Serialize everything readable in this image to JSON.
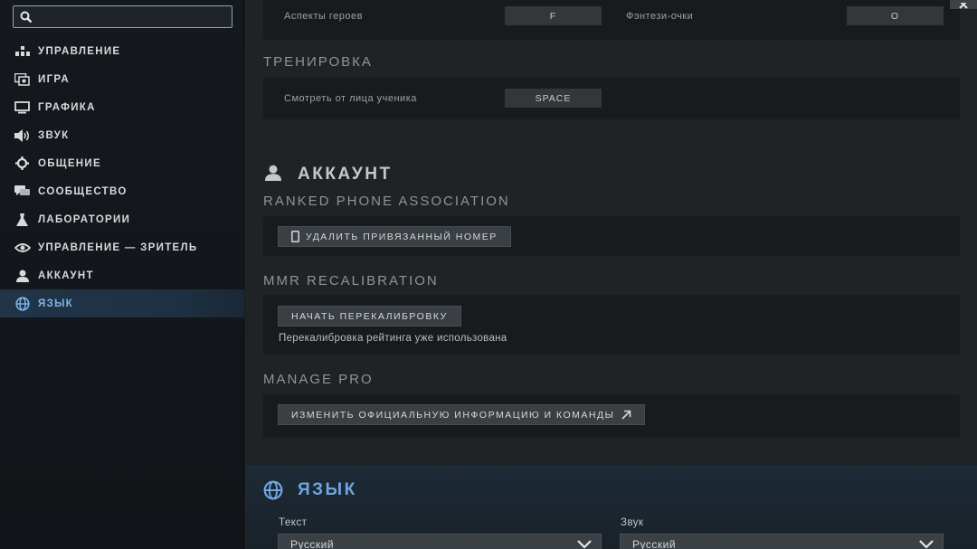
{
  "search": {
    "placeholder": "",
    "value": ""
  },
  "sidebar": {
    "items": [
      {
        "label": "УПРАВЛЕНИЕ",
        "icon": "controls-icon"
      },
      {
        "label": "ИГРА",
        "icon": "game-icon"
      },
      {
        "label": "ГРАФИКА",
        "icon": "monitor-icon"
      },
      {
        "label": "ЗВУК",
        "icon": "speaker-icon"
      },
      {
        "label": "ОБЩЕНИЕ",
        "icon": "gear-icon"
      },
      {
        "label": "СООБЩЕСТВО",
        "icon": "chat-icon"
      },
      {
        "label": "ЛАБОРАТОРИИ",
        "icon": "flask-icon"
      },
      {
        "label": "УПРАВЛЕНИЕ — ЗРИТЕЛЬ",
        "icon": "eye-icon"
      },
      {
        "label": "АККАУНТ",
        "icon": "user-icon"
      },
      {
        "label": "ЯЗЫК",
        "icon": "globe-icon",
        "active": true
      }
    ]
  },
  "keybinds_top": {
    "left": {
      "label": "Аспекты героев",
      "key": "F"
    },
    "right": {
      "label": "Фэнтези-очки",
      "key": "O"
    }
  },
  "training": {
    "heading": "ТРЕНИРОВКА",
    "row": {
      "label": "Смотреть от лица ученика",
      "key": "SPACE"
    }
  },
  "account": {
    "title": "АККАУНТ",
    "phone_heading": "RANKED PHONE ASSOCIATION",
    "phone_button": "УДАЛИТЬ ПРИВЯЗАННЫЙ НОМЕР",
    "mmr_heading": "MMR RECALIBRATION",
    "mmr_button": "НАЧАТЬ ПЕРЕКАЛИБРОВКУ",
    "mmr_note": "Перекалибровка рейтинга уже использована",
    "pro_heading": "MANAGE PRO",
    "pro_button": "ИЗМЕНИТЬ ОФИЦИАЛЬНУЮ ИНФОРМАЦИЮ И КОМАНДЫ"
  },
  "language": {
    "title": "ЯЗЫК",
    "text_label": "Текст",
    "text_value": "Русский",
    "sound_label": "Звук",
    "sound_value": "Русский"
  },
  "colors": {
    "accent": "#6fa6df",
    "active_nav_bg": "#223548"
  }
}
